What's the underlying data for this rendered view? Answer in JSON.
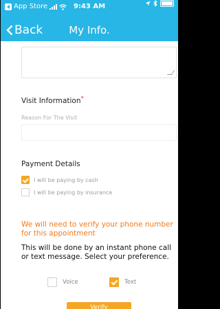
{
  "status_bar": {
    "carrier": "App Store",
    "time": "9:43 AM"
  },
  "nav": {
    "back_label": "Back",
    "title": "My Info."
  },
  "visit": {
    "title": "Visit Information",
    "required_mark": "*",
    "reason_label": "Reason For The Visit"
  },
  "payment": {
    "title": "Payment Details",
    "options": [
      {
        "label": "I will be paying by cash",
        "checked": true
      },
      {
        "label": "I will be paying by insurance",
        "checked": false
      }
    ]
  },
  "verification": {
    "notice": "We will need to verify your phone number for this appointment",
    "description": "This will be done by an instant phone call or text message. Select your preference.",
    "voice_label": "Voice",
    "voice_checked": false,
    "text_label": "Text",
    "text_checked": true,
    "verify_label": "Verify"
  },
  "colors": {
    "nav": "#27b6e6",
    "accent": "#f5a623",
    "notice": "#f27a1a"
  }
}
